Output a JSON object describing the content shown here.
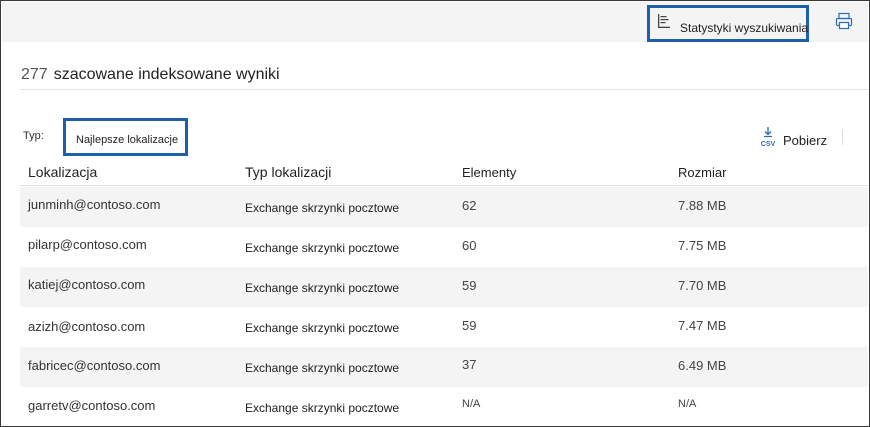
{
  "toolbar": {
    "stats_label": "Statystyki wyszukiwania",
    "stats_icon": "stats-report-icon",
    "print_icon": "print-icon"
  },
  "summary": {
    "count": "277",
    "label": "szacowane indeksowane wyniki"
  },
  "filter": {
    "type_label": "Typ:",
    "type_value": "Najlepsze lokalizacje"
  },
  "download": {
    "label": "Pobierz",
    "icon": "csv-download-icon"
  },
  "table": {
    "headers": [
      "Lokalizacja",
      "Typ lokalizacji",
      "Elementy",
      "Rozmiar"
    ],
    "rows": [
      {
        "location": "junminh@contoso.com",
        "type": "Exchange skrzynki pocztowe",
        "items": "62",
        "size": "7.88 MB"
      },
      {
        "location": "pilarp@contoso.com",
        "type": "Exchange skrzynki pocztowe",
        "items": "60",
        "size": "7.75 MB"
      },
      {
        "location": "katiej@contoso.com",
        "type": "Exchange skrzynki pocztowe",
        "items": "59",
        "size": "7.70 MB"
      },
      {
        "location": "azizh@contoso.com",
        "type": "Exchange skrzynki pocztowe",
        "items": "59",
        "size": "7.47 MB"
      },
      {
        "location": "fabricec@contoso.com",
        "type": "Exchange skrzynki pocztowe",
        "items": "37",
        "size": "6.49 MB"
      },
      {
        "location": "garretv@contoso.com",
        "type": "Exchange skrzynki pocztowe",
        "items": "N/A",
        "size": "N/A"
      }
    ]
  },
  "colors": {
    "highlight_border": "#1f5fa9",
    "alt_row": "#f4f4f4",
    "icon_blue": "#2a6db5"
  }
}
